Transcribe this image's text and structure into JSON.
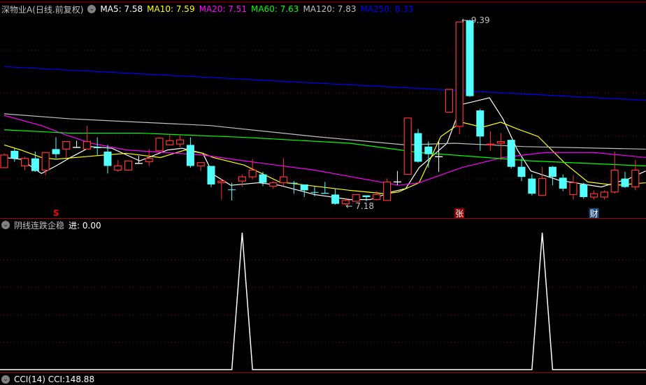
{
  "header": {
    "title": "深物业A(日线.前复权)",
    "ma_labels": [
      {
        "text": "MA5: 7.58",
        "color": "#ffffff"
      },
      {
        "text": "MA10: 7.59",
        "color": "#ffff00"
      },
      {
        "text": "MA20: 7.51",
        "color": "#ff00ff"
      },
      {
        "text": "MA60: 7.63",
        "color": "#00ff00"
      },
      {
        "text": "MA120: 7.83",
        "color": "#c0c0c0"
      },
      {
        "text": "MA250: 8.33",
        "color": "#0000ff"
      }
    ]
  },
  "indicator": {
    "title": "阴线连跌企稳",
    "value_label": "进: 0.00",
    "values": [
      0,
      0,
      0,
      0,
      0,
      0,
      0,
      0,
      0,
      0,
      0,
      0,
      0,
      0,
      0,
      0,
      0,
      0,
      0,
      0,
      0,
      0,
      0,
      1,
      0,
      0,
      0,
      0,
      0,
      0,
      0,
      0,
      0,
      0,
      0,
      0,
      0,
      0,
      0,
      0,
      0,
      0,
      0,
      0,
      0,
      0,
      0,
      0,
      0,
      0,
      0,
      0,
      1,
      0,
      0,
      0,
      0,
      0,
      0,
      0,
      0,
      0
    ]
  },
  "bottom_indicator": {
    "label": "CCI(14) CCI:148.88"
  },
  "colors": {
    "up": "#ff3232",
    "down": "#54ffff",
    "doji": "#ffffff",
    "grid": "#8b0000",
    "frame": "#a00000"
  },
  "chart_data": {
    "type": "candlestick",
    "price_range": [
      7.1,
      9.45
    ],
    "grid": true,
    "candles_ohlc": [
      [
        7.63,
        7.8,
        7.63,
        7.78
      ],
      [
        7.83,
        7.86,
        7.7,
        7.74
      ],
      [
        7.65,
        7.76,
        7.6,
        7.74
      ],
      [
        7.74,
        7.82,
        7.58,
        7.59
      ],
      [
        7.6,
        7.81,
        7.54,
        7.81
      ],
      [
        7.85,
        7.99,
        7.74,
        7.79
      ],
      [
        7.85,
        7.94,
        7.75,
        7.94
      ],
      [
        7.87,
        7.95,
        7.87,
        7.87
      ],
      [
        7.85,
        8.13,
        7.85,
        7.94
      ],
      [
        7.87,
        7.99,
        7.78,
        7.865
      ],
      [
        7.82,
        7.9,
        7.56,
        7.65
      ],
      [
        7.6,
        7.72,
        7.58,
        7.65
      ],
      [
        7.6,
        7.71,
        7.6,
        7.71
      ],
      [
        7.68,
        7.77,
        7.68,
        7.68
      ],
      [
        7.7,
        7.85,
        7.65,
        7.74
      ],
      [
        7.83,
        7.99,
        7.83,
        7.98
      ],
      [
        7.9,
        8.02,
        7.9,
        7.95
      ],
      [
        7.91,
        8.02,
        7.87,
        7.96
      ],
      [
        7.9,
        7.99,
        7.63,
        7.65
      ],
      [
        7.65,
        7.69,
        7.59,
        7.69
      ],
      [
        7.65,
        7.65,
        7.4,
        7.43
      ],
      [
        7.45,
        7.5,
        7.25,
        7.47
      ],
      [
        7.37,
        7.45,
        7.24,
        7.365
      ],
      [
        7.47,
        7.55,
        7.4,
        7.52
      ],
      [
        7.52,
        7.73,
        7.49,
        7.6
      ],
      [
        7.55,
        7.58,
        7.41,
        7.45
      ],
      [
        7.41,
        7.47,
        7.38,
        7.45
      ],
      [
        7.45,
        7.74,
        7.41,
        7.52
      ],
      [
        7.45,
        7.47,
        7.32,
        7.44
      ],
      [
        7.43,
        7.43,
        7.28,
        7.36
      ],
      [
        7.34,
        7.41,
        7.29,
        7.335
      ],
      [
        7.33,
        7.46,
        7.32,
        7.32
      ],
      [
        7.31,
        7.38,
        7.19,
        7.2
      ],
      [
        7.2,
        7.27,
        7.18,
        7.24
      ],
      [
        7.23,
        7.31,
        7.23,
        7.31
      ],
      [
        7.3,
        7.3,
        7.23,
        7.28
      ],
      [
        7.25,
        7.35,
        7.24,
        7.31
      ],
      [
        7.24,
        7.5,
        7.24,
        7.46
      ],
      [
        7.46,
        7.59,
        7.42,
        7.46
      ],
      [
        7.55,
        8.22,
        7.55,
        8.22
      ],
      [
        8.04,
        8.09,
        7.69,
        7.7
      ],
      [
        7.88,
        7.94,
        7.63,
        7.79
      ],
      [
        7.76,
        7.94,
        7.58,
        7.76
      ],
      [
        8.29,
        8.56,
        8.28,
        8.56
      ],
      [
        8.12,
        9.36,
        8.03,
        9.36
      ],
      [
        9.38,
        9.39,
        8.47,
        8.48
      ],
      [
        8.31,
        8.33,
        7.83,
        8.0
      ],
      [
        7.9,
        8.06,
        7.83,
        7.91
      ],
      [
        7.92,
        8.04,
        7.72,
        7.94
      ],
      [
        7.96,
        7.96,
        7.62,
        7.64
      ],
      [
        7.64,
        7.74,
        7.47,
        7.52
      ],
      [
        7.5,
        7.55,
        7.3,
        7.32
      ],
      [
        7.3,
        7.64,
        7.3,
        7.5
      ],
      [
        7.64,
        7.65,
        7.42,
        7.52
      ],
      [
        7.51,
        7.55,
        7.35,
        7.38
      ],
      [
        7.31,
        7.54,
        7.25,
        7.45
      ],
      [
        7.43,
        7.45,
        7.26,
        7.28
      ],
      [
        7.28,
        7.36,
        7.25,
        7.32
      ],
      [
        7.28,
        7.36,
        7.25,
        7.34
      ],
      [
        7.34,
        7.82,
        7.32,
        7.6
      ],
      [
        7.5,
        7.58,
        7.39,
        7.4
      ],
      [
        7.4,
        7.72,
        7.36,
        7.6
      ]
    ],
    "moving_averages": [
      {
        "name": "MA5",
        "color": "#ffffff",
        "points": [
          [
            0,
            7.75
          ],
          [
            1.6,
            7.73
          ],
          [
            3,
            7.61
          ],
          [
            3.6,
            7.56
          ],
          [
            5,
            7.65
          ],
          [
            6.4,
            7.75
          ],
          [
            8.4,
            7.88
          ],
          [
            10.4,
            7.86
          ],
          [
            13.1,
            7.71
          ],
          [
            15.8,
            7.84
          ],
          [
            17.2,
            7.86
          ],
          [
            19.2,
            7.8
          ],
          [
            20.2,
            7.55
          ],
          [
            21.9,
            7.42
          ],
          [
            24.6,
            7.45
          ],
          [
            26.6,
            7.42
          ],
          [
            30,
            7.31
          ],
          [
            33.4,
            7.25
          ],
          [
            35.4,
            7.25
          ],
          [
            37.4,
            7.34
          ],
          [
            38.8,
            7.38
          ],
          [
            40.1,
            7.63
          ],
          [
            42.8,
            7.92
          ],
          [
            44.2,
            8.38
          ],
          [
            46.9,
            8.46
          ],
          [
            48.2,
            8.21
          ],
          [
            49.6,
            7.84
          ],
          [
            50.9,
            7.59
          ],
          [
            53.6,
            7.48
          ],
          [
            57.7,
            7.4
          ],
          [
            60.4,
            7.5
          ],
          [
            62,
            7.59
          ]
        ]
      },
      {
        "name": "MA10",
        "color": "#ffff00",
        "points": [
          [
            0,
            7.9
          ],
          [
            1.6,
            7.84
          ],
          [
            3.6,
            7.75
          ],
          [
            5,
            7.73
          ],
          [
            9.7,
            7.78
          ],
          [
            11.8,
            7.8
          ],
          [
            15.1,
            7.75
          ],
          [
            17.5,
            7.84
          ],
          [
            19.2,
            7.8
          ],
          [
            20.2,
            7.75
          ],
          [
            23.2,
            7.66
          ],
          [
            26.6,
            7.46
          ],
          [
            29.3,
            7.42
          ],
          [
            33.4,
            7.36
          ],
          [
            36.8,
            7.32
          ],
          [
            38.1,
            7.34
          ],
          [
            40.1,
            7.45
          ],
          [
            42.2,
            8.0
          ],
          [
            44.2,
            8.17
          ],
          [
            46.2,
            8.11
          ],
          [
            48,
            8.17
          ],
          [
            49.6,
            8.09
          ],
          [
            51.6,
            8.0
          ],
          [
            54.3,
            7.67
          ],
          [
            56.4,
            7.46
          ],
          [
            59.1,
            7.42
          ],
          [
            62,
            7.45
          ]
        ]
      },
      {
        "name": "MA20",
        "color": "#ff00ff",
        "points": [
          [
            0,
            8.25
          ],
          [
            3.6,
            8.13
          ],
          [
            5.7,
            8.03
          ],
          [
            8.4,
            7.92
          ],
          [
            11.8,
            7.84
          ],
          [
            19.2,
            7.78
          ],
          [
            23.2,
            7.71
          ],
          [
            30,
            7.6
          ],
          [
            35.4,
            7.48
          ],
          [
            38.1,
            7.42
          ],
          [
            40.1,
            7.45
          ],
          [
            44.2,
            7.63
          ],
          [
            48.2,
            7.75
          ],
          [
            52.3,
            7.81
          ],
          [
            57,
            7.81
          ],
          [
            62,
            7.75
          ]
        ]
      },
      {
        "name": "MA60",
        "color": "#00ff00",
        "points": [
          [
            0,
            8.08
          ],
          [
            6.4,
            8.04
          ],
          [
            13.1,
            8.04
          ],
          [
            23.2,
            7.99
          ],
          [
            33.4,
            7.92
          ],
          [
            40.1,
            7.81
          ],
          [
            50.9,
            7.71
          ],
          [
            62,
            7.65
          ]
        ]
      },
      {
        "name": "MA120",
        "color": "#c0c0c0",
        "points": [
          [
            0,
            8.27
          ],
          [
            6.4,
            8.21
          ],
          [
            19.9,
            8.13
          ],
          [
            30,
            8.0
          ],
          [
            38.8,
            7.9
          ],
          [
            43.5,
            7.92
          ],
          [
            50.3,
            7.88
          ],
          [
            62,
            7.85
          ]
        ]
      },
      {
        "name": "MA250",
        "color": "#0000ff",
        "points": [
          [
            0,
            8.83
          ],
          [
            62,
            8.43
          ]
        ]
      }
    ],
    "annotations": [
      {
        "text": "9.39",
        "index": 45,
        "price": 9.39,
        "type": "high"
      },
      {
        "text": "7.18",
        "index": 33,
        "price": 7.18,
        "type": "low"
      },
      {
        "text": "S",
        "index": 5,
        "color": "#ff0000",
        "type": "signal"
      },
      {
        "text": "张",
        "index": 44,
        "color": "#8b0000",
        "type": "badge"
      },
      {
        "text": "财",
        "index": 57,
        "color": "#1a4a7a",
        "type": "badge"
      }
    ]
  }
}
